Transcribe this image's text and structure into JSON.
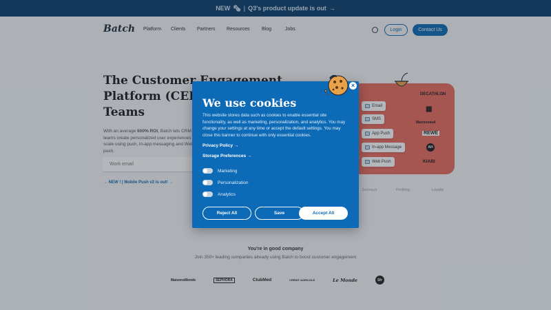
{
  "announcement": {
    "new": "NEW",
    "icon": "🗞",
    "sep": "|",
    "text": "Q3's product update is out",
    "arrow": "→"
  },
  "nav": {
    "logo": "Batch",
    "links": [
      "Platform",
      "Clients",
      "Partners",
      "Resources",
      "Blog",
      "Jobs"
    ],
    "globe_icon": "globe-icon",
    "login": "Login",
    "contact": "Contact Us"
  },
  "hero": {
    "title_lines": [
      "The Customer Engagement",
      "Platform (CEP) for",
      "Teams"
    ],
    "desc_pre": "With an average ",
    "desc_bold": "600% ROI",
    "desc_post": ", Batch lets CRM teams create personalized user experiences at scale using push, in-app messaging and Web push.",
    "email_placeholder": "Work email",
    "new_link": "→ NEW ! | Mobile Push v2 is out! →"
  },
  "channels": [
    "Email",
    "SMS",
    "App Push",
    "In-app Message",
    "Web Push"
  ],
  "brands": [
    "DECATHLON",
    "Amazon",
    "Marionnaud",
    "REWE",
    "AH",
    "KIABI"
  ],
  "under_labels": [
    "Journeys",
    "Profiling",
    "Loyalty"
  ],
  "company": {
    "title": "You're in good company",
    "subtitle": "Join 350+ leading companies already using Batch to boost customer engagement",
    "clients": [
      "MaisonsMonde",
      "SEPHORA",
      "ClubMed",
      "CRÉDIT AGRICOLE",
      "Le Monde",
      "Sfr"
    ]
  },
  "modal": {
    "title": "We use cookies",
    "body": "This website stores data such as cookies to enable essential site functionality, as well as marketing, personalization, and analytics. You may change your settings at any time or accept the default settings. You may close this banner to continue with only essential cookies.",
    "privacy": "Privacy Policy →",
    "storage": "Storage Preferences →",
    "toggles": [
      "Marketing",
      "Personalization",
      "Analytics"
    ],
    "reject": "Reject All",
    "save": "Save",
    "accept": "Accept All",
    "close": "×"
  },
  "colors": {
    "primary": "#0c6ab6",
    "banner": "#0a3d6b",
    "card": "#e86a5c"
  }
}
